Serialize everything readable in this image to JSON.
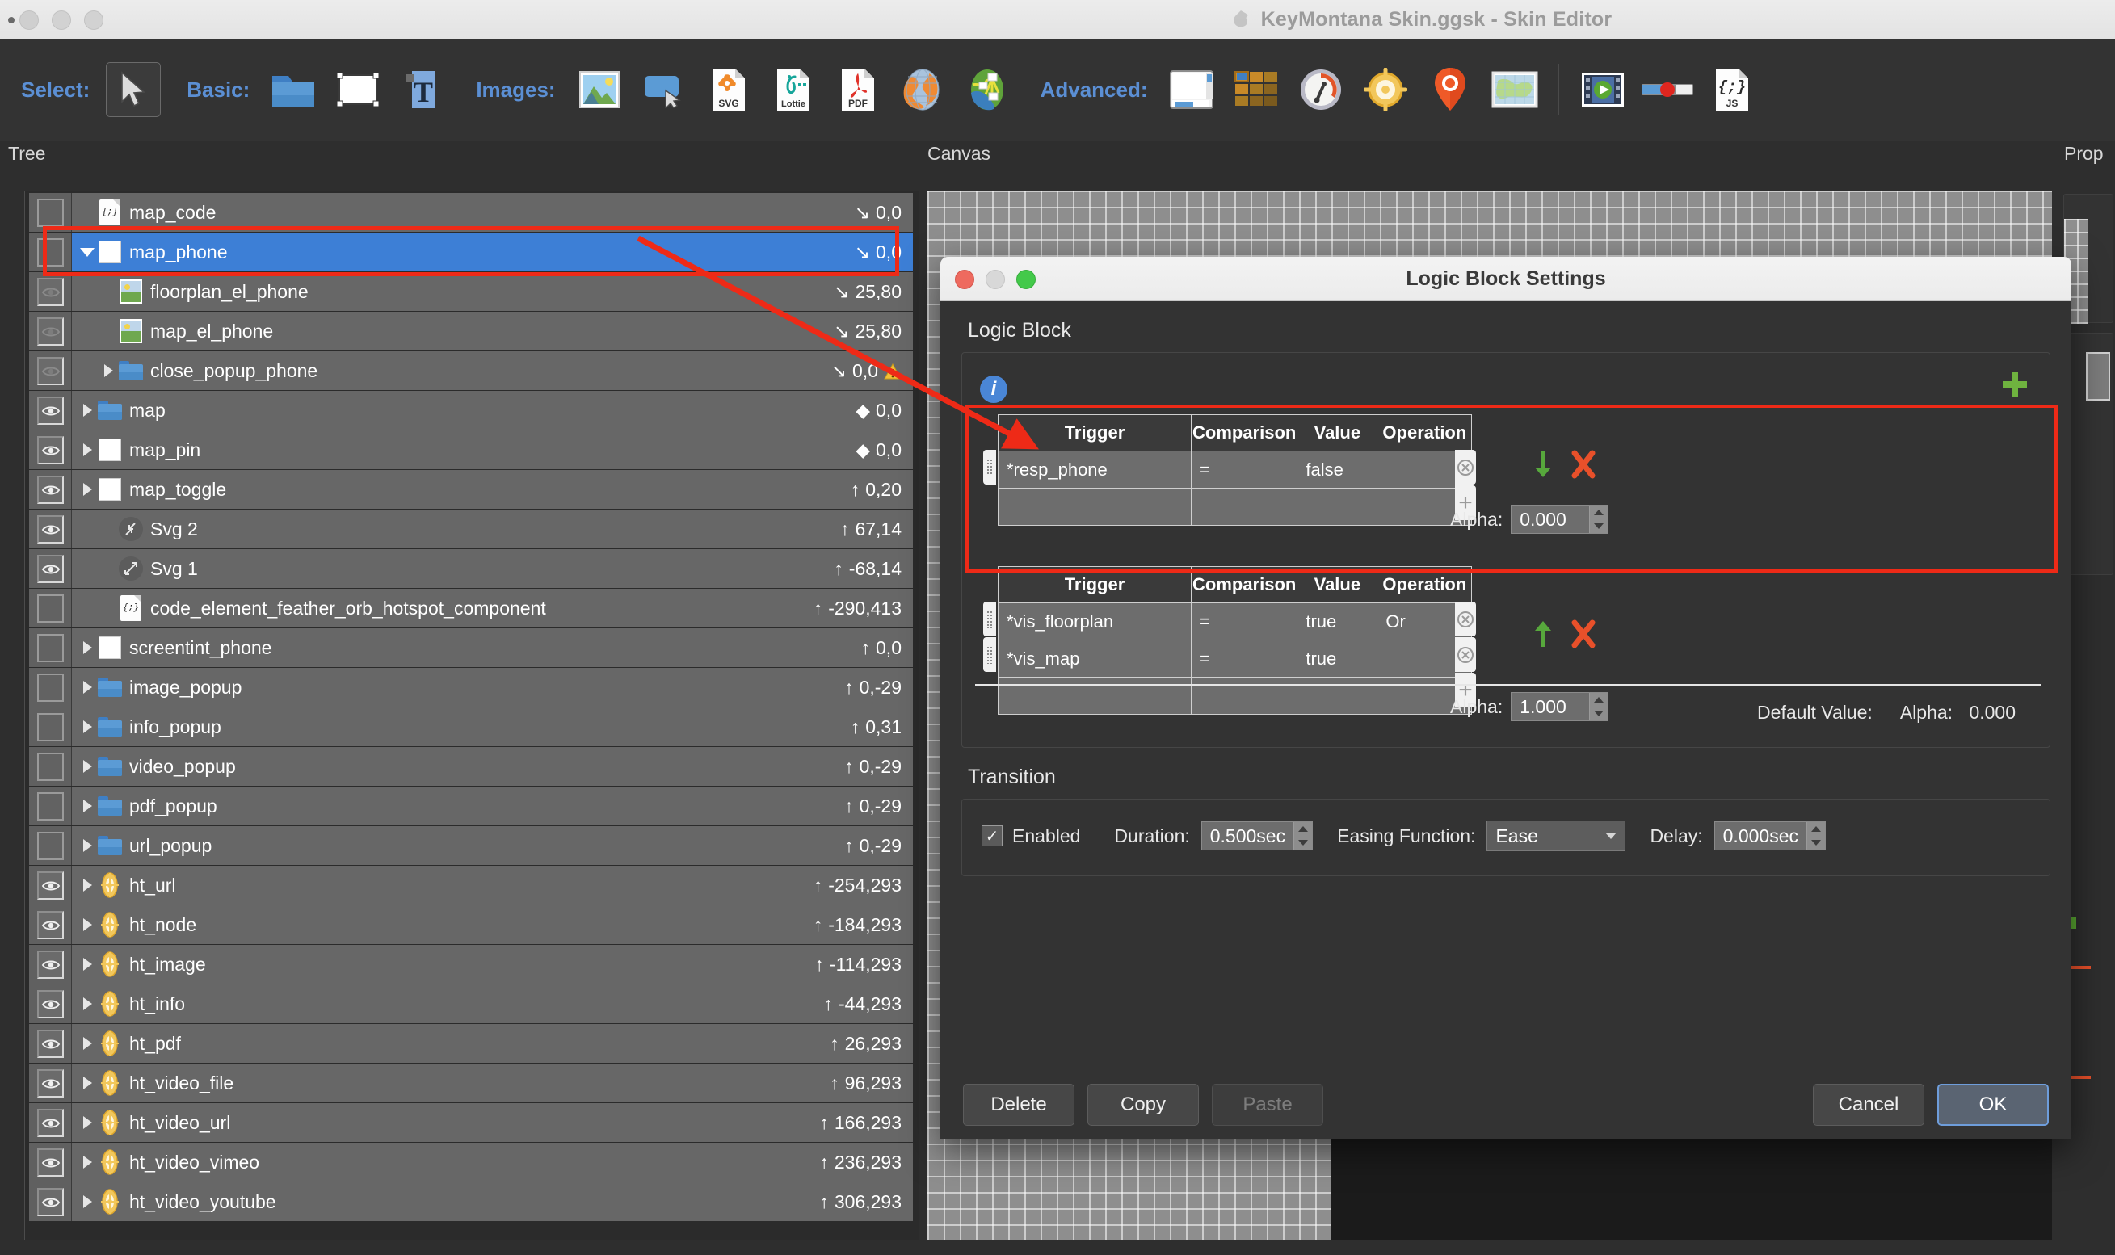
{
  "window": {
    "title": "KeyMontana Skin.ggsk - Skin Editor",
    "app_icon": "app-icon"
  },
  "toolbar": {
    "groups": [
      {
        "label": "Select:",
        "items": [
          {
            "icon": "cursor-arrow-icon",
            "selected": true
          }
        ]
      },
      {
        "label": "Basic:",
        "items": [
          {
            "icon": "folder-icon"
          },
          {
            "icon": "rectangle-icon"
          },
          {
            "icon": "text-icon"
          }
        ]
      },
      {
        "label": "Images:",
        "items": [
          {
            "icon": "image-icon"
          },
          {
            "icon": "button-icon"
          },
          {
            "icon": "svg-file-icon"
          },
          {
            "icon": "lottie-file-icon"
          },
          {
            "icon": "pdf-file-icon"
          },
          {
            "icon": "globe-icon"
          },
          {
            "icon": "node-graph-icon"
          }
        ]
      },
      {
        "label": "Advanced:",
        "items": [
          {
            "icon": "container-icon"
          },
          {
            "icon": "grid-icon"
          },
          {
            "icon": "compass-icon"
          },
          {
            "icon": "hotspot-icon"
          },
          {
            "icon": "map-pin-icon"
          },
          {
            "icon": "world-map-icon"
          },
          {
            "icon": "video-icon"
          },
          {
            "icon": "slider-icon"
          },
          {
            "icon": "js-file-icon"
          }
        ]
      }
    ]
  },
  "panels": {
    "tree_label": "Tree",
    "canvas_label": "Canvas",
    "properties_label": "Prop"
  },
  "tree": {
    "rows": [
      {
        "name": "map_code",
        "coord": "0,0",
        "dir": "down-right",
        "icon": "js-file-icon",
        "indent": 1,
        "twisty": "none",
        "vis": "off",
        "selected": false,
        "warn": false
      },
      {
        "name": "map_phone",
        "coord": "0,0",
        "dir": "down-right",
        "icon": "rectangle-icon",
        "indent": 1,
        "twisty": "open",
        "vis": "off",
        "selected": true,
        "warn": false
      },
      {
        "name": "floorplan_el_phone",
        "coord": "25,80",
        "dir": "down-right",
        "icon": "image-icon",
        "indent": 2,
        "twisty": "none",
        "vis": "dim-eye",
        "selected": false,
        "warn": false
      },
      {
        "name": "map_el_phone",
        "coord": "25,80",
        "dir": "down-right",
        "icon": "image-icon",
        "indent": 2,
        "twisty": "none",
        "vis": "dim-eye",
        "selected": false,
        "warn": false
      },
      {
        "name": "close_popup_phone",
        "coord": "0,0",
        "dir": "down-right",
        "icon": "folder-icon",
        "indent": 2,
        "twisty": "closed",
        "vis": "dim-eye",
        "selected": false,
        "warn": true
      },
      {
        "name": "map",
        "coord": "0,0",
        "dir": "diamond",
        "icon": "folder-icon",
        "indent": 1,
        "twisty": "closed",
        "vis": "eye",
        "selected": false,
        "warn": false
      },
      {
        "name": "map_pin",
        "coord": "0,0",
        "dir": "diamond",
        "icon": "rectangle-icon",
        "indent": 1,
        "twisty": "closed",
        "vis": "eye",
        "selected": false,
        "warn": false
      },
      {
        "name": "map_toggle",
        "coord": "0,20",
        "dir": "up",
        "icon": "rectangle-icon",
        "indent": 1,
        "twisty": "closed",
        "vis": "eye",
        "selected": false,
        "warn": false
      },
      {
        "name": "Svg 2",
        "coord": "67,14",
        "dir": "up",
        "icon": "svg-collapse-icon",
        "indent": 2,
        "twisty": "none",
        "vis": "eye",
        "selected": false,
        "warn": false
      },
      {
        "name": "Svg 1",
        "coord": "-68,14",
        "dir": "up",
        "icon": "svg-expand-icon",
        "indent": 2,
        "twisty": "none",
        "vis": "eye",
        "selected": false,
        "warn": false
      },
      {
        "name": "code_element_feather_orb_hotspot_component",
        "coord": "-290,413",
        "dir": "up",
        "icon": "js-file-icon",
        "indent": 2,
        "twisty": "none",
        "vis": "off",
        "selected": false,
        "warn": false
      },
      {
        "name": "screentint_phone",
        "coord": "0,0",
        "dir": "up",
        "icon": "rectangle-icon",
        "indent": 1,
        "twisty": "closed",
        "vis": "off",
        "selected": false,
        "warn": false
      },
      {
        "name": "image_popup",
        "coord": "0,-29",
        "dir": "up",
        "icon": "folder-icon",
        "indent": 1,
        "twisty": "closed",
        "vis": "off",
        "selected": false,
        "warn": false
      },
      {
        "name": "info_popup",
        "coord": "0,31",
        "dir": "up",
        "icon": "folder-icon",
        "indent": 1,
        "twisty": "closed",
        "vis": "off",
        "selected": false,
        "warn": false
      },
      {
        "name": "video_popup",
        "coord": "0,-29",
        "dir": "up",
        "icon": "folder-icon",
        "indent": 1,
        "twisty": "closed",
        "vis": "off",
        "selected": false,
        "warn": false
      },
      {
        "name": "pdf_popup",
        "coord": "0,-29",
        "dir": "up",
        "icon": "folder-icon",
        "indent": 1,
        "twisty": "closed",
        "vis": "off",
        "selected": false,
        "warn": false
      },
      {
        "name": "url_popup",
        "coord": "0,-29",
        "dir": "up",
        "icon": "folder-icon",
        "indent": 1,
        "twisty": "closed",
        "vis": "off",
        "selected": false,
        "warn": false
      },
      {
        "name": "ht_url",
        "coord": "-254,293",
        "dir": "up",
        "icon": "hotspot-icon",
        "indent": 1,
        "twisty": "closed",
        "vis": "eye",
        "selected": false,
        "warn": false
      },
      {
        "name": "ht_node",
        "coord": "-184,293",
        "dir": "up",
        "icon": "hotspot-icon",
        "indent": 1,
        "twisty": "closed",
        "vis": "eye",
        "selected": false,
        "warn": false
      },
      {
        "name": "ht_image",
        "coord": "-114,293",
        "dir": "up",
        "icon": "hotspot-icon",
        "indent": 1,
        "twisty": "closed",
        "vis": "eye",
        "selected": false,
        "warn": false
      },
      {
        "name": "ht_info",
        "coord": "-44,293",
        "dir": "up",
        "icon": "hotspot-icon",
        "indent": 1,
        "twisty": "closed",
        "vis": "eye",
        "selected": false,
        "warn": false
      },
      {
        "name": "ht_pdf",
        "coord": "26,293",
        "dir": "up",
        "icon": "hotspot-icon",
        "indent": 1,
        "twisty": "closed",
        "vis": "eye",
        "selected": false,
        "warn": false
      },
      {
        "name": "ht_video_file",
        "coord": "96,293",
        "dir": "up",
        "icon": "hotspot-icon",
        "indent": 1,
        "twisty": "closed",
        "vis": "eye",
        "selected": false,
        "warn": false
      },
      {
        "name": "ht_video_url",
        "coord": "166,293",
        "dir": "up",
        "icon": "hotspot-icon",
        "indent": 1,
        "twisty": "closed",
        "vis": "eye",
        "selected": false,
        "warn": false
      },
      {
        "name": "ht_video_vimeo",
        "coord": "236,293",
        "dir": "up",
        "icon": "hotspot-icon",
        "indent": 1,
        "twisty": "closed",
        "vis": "eye",
        "selected": false,
        "warn": false
      },
      {
        "name": "ht_video_youtube",
        "coord": "306,293",
        "dir": "up",
        "icon": "hotspot-icon",
        "indent": 1,
        "twisty": "closed",
        "vis": "eye",
        "selected": false,
        "warn": false
      }
    ]
  },
  "dialog": {
    "title": "Logic Block Settings",
    "logic_block_label": "Logic Block",
    "columns": [
      "Trigger",
      "Comparison",
      "Value",
      "Operation"
    ],
    "conditions": [
      {
        "highlighted": true,
        "move_arrow": "down",
        "rows": [
          {
            "trigger": "*resp_phone",
            "comparison": "=",
            "value": "false",
            "operation": ""
          }
        ],
        "alpha_label": "Alpha:",
        "alpha_value": "0.000"
      },
      {
        "highlighted": false,
        "move_arrow": "up",
        "rows": [
          {
            "trigger": "*vis_floorplan",
            "comparison": "=",
            "value": "true",
            "operation": "Or"
          },
          {
            "trigger": "*vis_map",
            "comparison": "=",
            "value": "true",
            "operation": ""
          }
        ],
        "alpha_label": "Alpha:",
        "alpha_value": "1.000"
      }
    ],
    "default_value_label": "Default Value:",
    "default_alpha_label": "Alpha:",
    "default_alpha_value": "0.000",
    "transition": {
      "section_label": "Transition",
      "enabled_label": "Enabled",
      "enabled": true,
      "duration_label": "Duration:",
      "duration_value": "0.500sec",
      "easing_label": "Easing Function:",
      "easing_value": "Ease",
      "delay_label": "Delay:",
      "delay_value": "0.000sec"
    },
    "buttons": {
      "delete": "Delete",
      "copy": "Copy",
      "paste": "Paste",
      "cancel": "Cancel",
      "ok": "OK"
    }
  },
  "colors": {
    "accent_blue": "#5b8fd4",
    "selection_blue": "#3d7fd6",
    "annotation_red": "#ee2a17",
    "green_arrow": "#57a83c",
    "orange_x": "#e8502a",
    "warning_yellow": "#f2c037"
  }
}
